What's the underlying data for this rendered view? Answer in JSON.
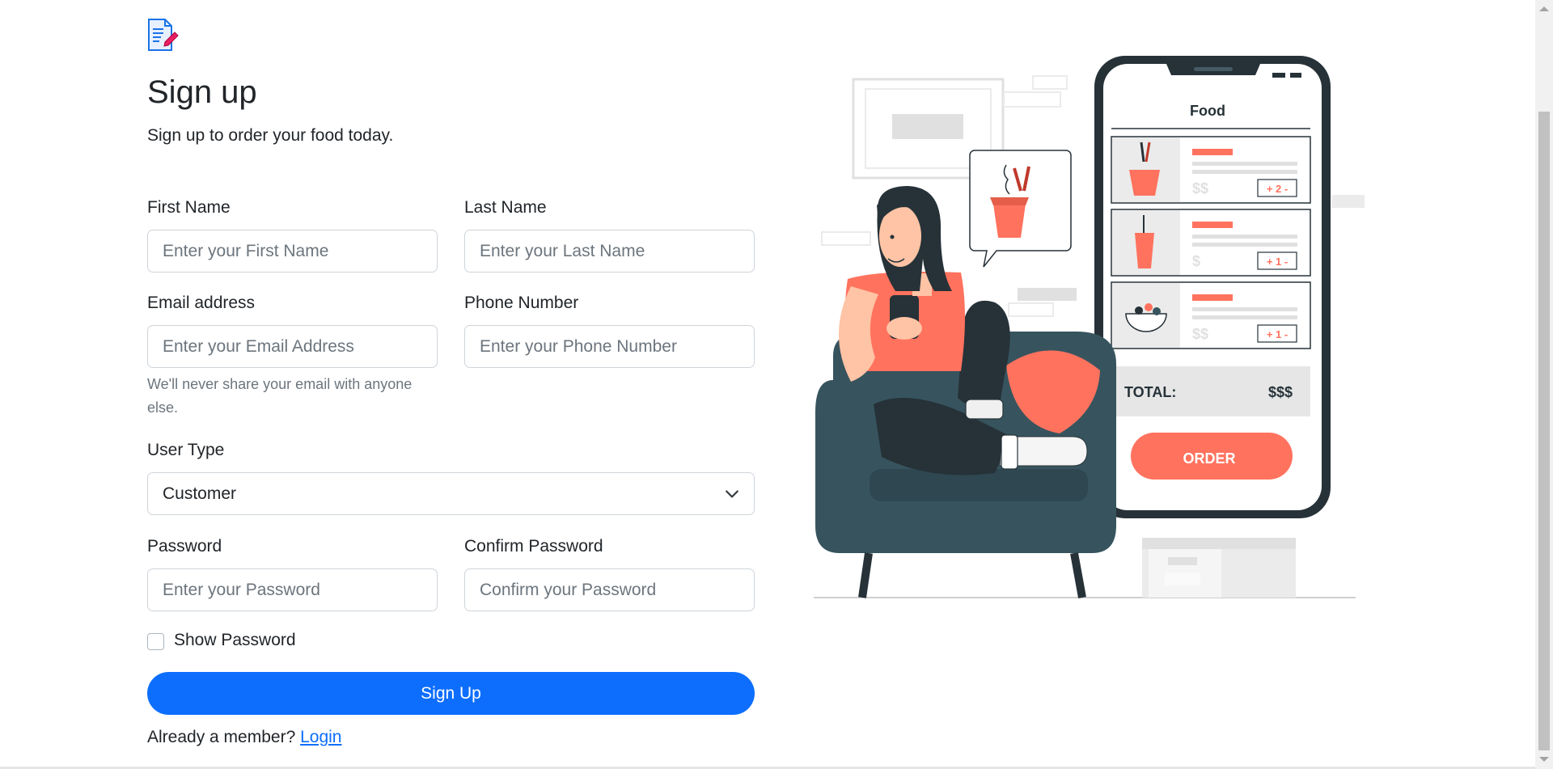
{
  "header": {
    "logo_icon": "document-edit-icon",
    "title": "Sign up",
    "subtitle": "Sign up to order your food today."
  },
  "form": {
    "first_name": {
      "label": "First Name",
      "placeholder": "Enter your First Name",
      "value": ""
    },
    "last_name": {
      "label": "Last Name",
      "placeholder": "Enter your Last Name",
      "value": ""
    },
    "email": {
      "label": "Email address",
      "placeholder": "Enter your Email Address",
      "value": "",
      "help": "We'll never share your email with anyone else."
    },
    "phone": {
      "label": "Phone Number",
      "placeholder": "Enter your Phone Number",
      "value": ""
    },
    "user_type": {
      "label": "User Type",
      "selected": "Customer"
    },
    "password": {
      "label": "Password",
      "placeholder": "Enter your Password",
      "value": ""
    },
    "confirm_password": {
      "label": "Confirm Password",
      "placeholder": "Confirm your Password",
      "value": ""
    },
    "show_password": {
      "label": "Show Password",
      "checked": false
    },
    "submit_label": "Sign Up",
    "member_text": "Already a member?",
    "login_link": "Login"
  },
  "illustration": {
    "app_title": "Food",
    "items": [
      {
        "price": "$$",
        "qty": "+ 2 -"
      },
      {
        "price": "$",
        "qty": "+ 1 -"
      },
      {
        "price": "$$",
        "qty": "+ 1 -"
      }
    ],
    "total_label": "TOTAL:",
    "total_value": "$$$",
    "order_label": "ORDER"
  },
  "colors": {
    "primary": "#0d6efd",
    "accent_coral": "#ff725e",
    "chair": "#37545e",
    "phone_frame": "#263238"
  }
}
